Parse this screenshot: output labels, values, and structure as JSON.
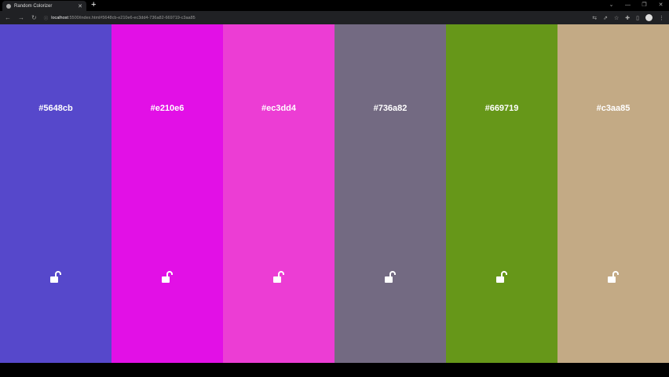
{
  "browser": {
    "tab_title": "Random Colorizer",
    "url_host": "localhost",
    "url_rest": ":5500/index.html#5648cb-e210e6-ec3dd4-736a82-669719-c3aa85"
  },
  "palette": [
    {
      "hex": "#5648cb",
      "color": "#5648cb",
      "lock": "unlocked-lock-icon"
    },
    {
      "hex": "#e210e6",
      "color": "#e210e6",
      "lock": "unlocked-lock-icon"
    },
    {
      "hex": "#ec3dd4",
      "color": "#ec3dd4",
      "lock": "unlocked-lock-icon"
    },
    {
      "hex": "#736a82",
      "color": "#736a82",
      "lock": "unlocked-lock-icon"
    },
    {
      "hex": "#669719",
      "color": "#669719",
      "lock": "unlocked-lock-icon"
    },
    {
      "hex": "#c3aa85",
      "color": "#c3aa85",
      "lock": "unlocked-lock-icon"
    }
  ]
}
